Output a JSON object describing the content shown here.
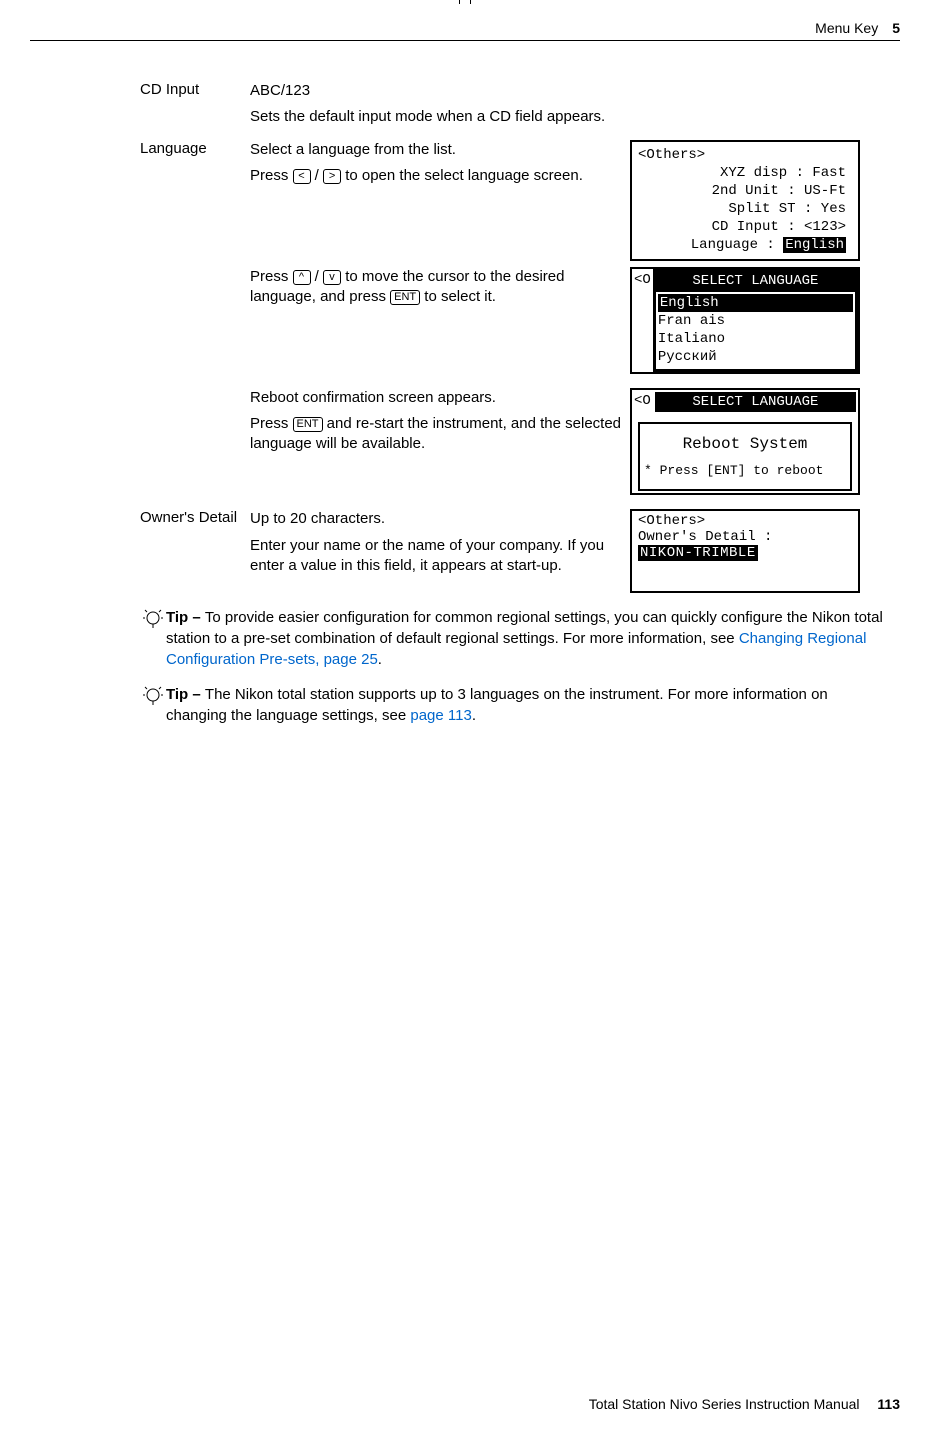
{
  "header": {
    "section": "Menu Key",
    "chapter": "5"
  },
  "footer": {
    "manual": "Total Station Nivo Series Instruction Manual",
    "page": "113"
  },
  "rows": {
    "cd_input": {
      "label": "CD Input",
      "value": "ABC/123",
      "desc": "Sets the default input mode when a CD field appears."
    },
    "language": {
      "label": "Language",
      "line1": "Select a language from the list.",
      "line2a": "Press ",
      "key_left": "<",
      "line2b": " / ",
      "key_right": ">",
      "line2c": " to open the select language screen.",
      "line3a": "Press ",
      "key_up": "^",
      "line3b": " / ",
      "key_down": "v",
      "line3c": " to move the cursor to the desired language, and press ",
      "key_ent1": "ENT",
      "line3d": " to select it.",
      "line4": "Reboot confirmation screen appears.",
      "line5a": "Press ",
      "key_ent2": "ENT",
      "line5b": " and re-start the instrument, and the selected language will be available."
    },
    "owner": {
      "label": "Owner's Detail",
      "line1": "Up to 20 characters.",
      "line2": "Enter your name or the name of your company. If you enter a value in this field, it appears at start-up."
    }
  },
  "screens": {
    "others": {
      "title": "<Others>",
      "l1": "XYZ disp : Fast",
      "l2": "2nd Unit : US-Ft",
      "l3": "Split ST : Yes",
      "l4": "CD Input : <123>",
      "l5a": "Language : ",
      "l5b": "English"
    },
    "select_lang": {
      "prefix": "<O",
      "title": "SELECT LANGUAGE",
      "items": [
        "English",
        "Fran ais",
        "Italiano",
        "Русский"
      ]
    },
    "reboot": {
      "prefix": "<O",
      "bar": "SELECT LANGUAGE",
      "msg": "Reboot System",
      "hint": "* Press [ENT] to reboot"
    },
    "owner_screen": {
      "title": "<Others>",
      "label": "Owner's Detail :",
      "value": "NIKON-TRIMBLE"
    }
  },
  "tips": {
    "t1": {
      "lead": "Tip – ",
      "body_a": "To provide easier configuration for common regional settings, you can quickly configure the Nikon total station to a pre-set combination of default regional settings. For more information, see ",
      "link": "Changing Regional Configuration Pre-sets, page 25",
      "body_b": "."
    },
    "t2": {
      "lead": "Tip – ",
      "body_a": "The Nikon total station supports up to 3 languages on the instrument. For more information on changing the language settings, see ",
      "link": "page 113",
      "body_b": "."
    }
  }
}
